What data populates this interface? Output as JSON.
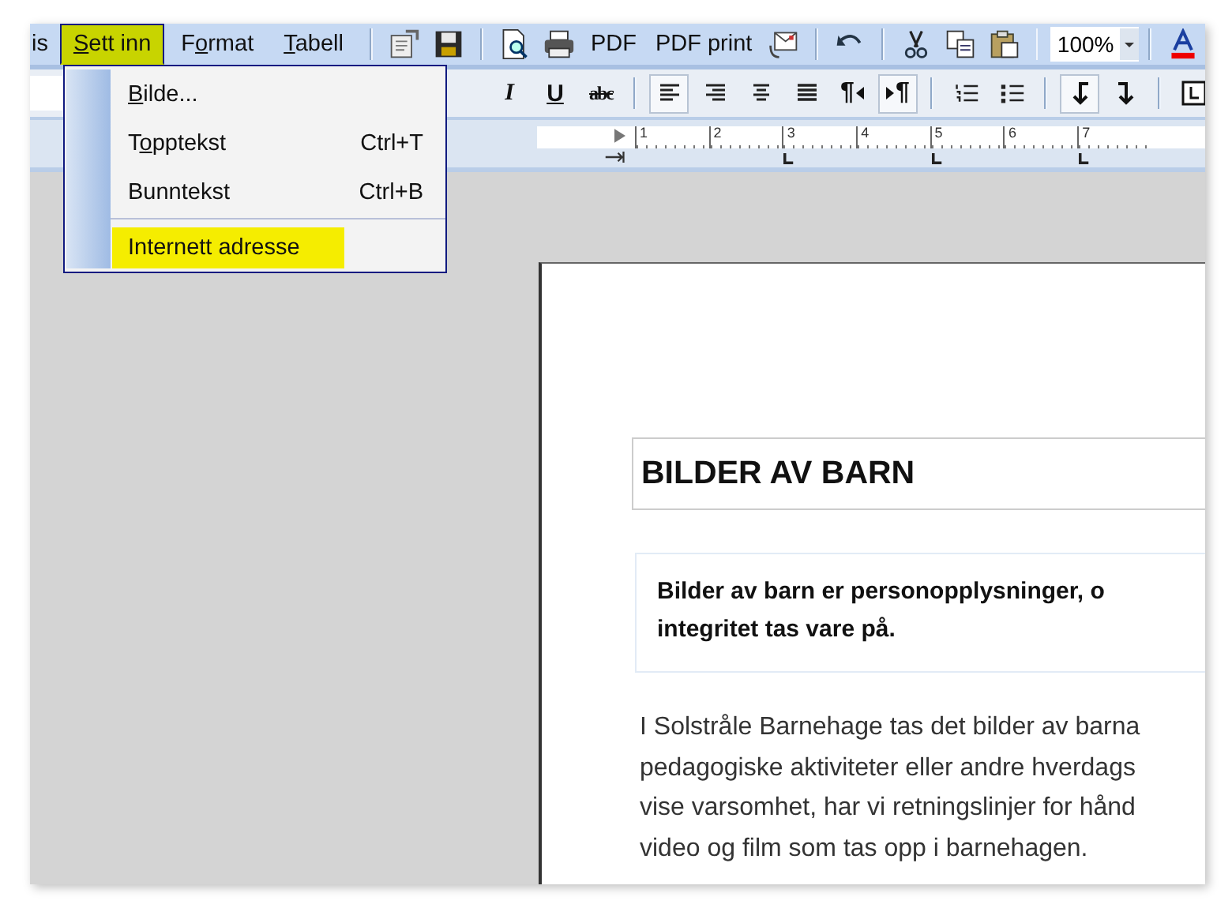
{
  "menu_bar": [
    {
      "label": {
        "before": "is"
      },
      "selected": false
    },
    {
      "label": {
        "key": "S",
        "after": "ett inn"
      },
      "selected": true
    },
    {
      "label": {
        "before": "F",
        "key": "o",
        "after": "rmat"
      },
      "selected": false
    },
    {
      "label": {
        "key": "T",
        "after": "abell"
      },
      "selected": false
    }
  ],
  "toolbar": [
    {
      "kind": "separator"
    },
    {
      "kind": "properties"
    },
    {
      "kind": "save"
    },
    {
      "kind": "separator"
    },
    {
      "kind": "preview"
    },
    {
      "kind": "print"
    },
    {
      "kind": "text",
      "label": "PDF"
    },
    {
      "kind": "text",
      "label": "PDF print"
    },
    {
      "kind": "mail"
    },
    {
      "kind": "separator"
    },
    {
      "kind": "undo"
    },
    {
      "kind": "separator"
    },
    {
      "kind": "cut"
    },
    {
      "kind": "copy"
    },
    {
      "kind": "paste"
    },
    {
      "kind": "separator"
    },
    {
      "kind": "zoom",
      "value": "100%"
    },
    {
      "kind": "separator"
    },
    {
      "kind": "font-color"
    }
  ],
  "format_toolbar": [
    {
      "kind": "italic",
      "label": "I",
      "pressed": false
    },
    {
      "kind": "underline",
      "label": "U",
      "pressed": false
    },
    {
      "kind": "strike",
      "label": "abc",
      "pressed": false
    },
    {
      "kind": "separator"
    },
    {
      "kind": "align-left",
      "pressed": true
    },
    {
      "kind": "align-right",
      "pressed": false
    },
    {
      "kind": "align-center",
      "pressed": false
    },
    {
      "kind": "justify",
      "pressed": false
    },
    {
      "kind": "para-rtl",
      "label": "¶",
      "pressed": false
    },
    {
      "kind": "para-ltr",
      "label": "¶",
      "pressed": true
    },
    {
      "kind": "separator"
    },
    {
      "kind": "numbered-list",
      "pressed": false
    },
    {
      "kind": "bullet-list",
      "pressed": false
    },
    {
      "kind": "separator"
    },
    {
      "kind": "arrow-left-down",
      "pressed": true
    },
    {
      "kind": "arrow-right-down",
      "pressed": false
    },
    {
      "kind": "separator"
    },
    {
      "kind": "frame",
      "pressed": false
    }
  ],
  "ruler": {
    "numbers": [
      "1",
      "2",
      "3",
      "4",
      "5",
      "6",
      "7"
    ]
  },
  "dropdown": {
    "items": [
      {
        "kind": "item",
        "label": {
          "key": "B",
          "after": "ilde..."
        },
        "selected": false
      },
      {
        "kind": "item",
        "label": {
          "before": "T",
          "key": "o",
          "after": "pptekst"
        },
        "shortcut": "Ctrl+T",
        "selected": false
      },
      {
        "kind": "item",
        "label": {
          "before": "Bunntekst"
        },
        "shortcut": "Ctrl+B",
        "selected": false
      },
      {
        "kind": "separator"
      },
      {
        "kind": "item",
        "label": {
          "before": "Internett adresse"
        },
        "selected": true
      }
    ]
  },
  "document": {
    "heading": "BILDER AV BARN",
    "callout": [
      "Bilder av barn er personopplysninger, o",
      "integritet tas vare på."
    ],
    "paragraph": [
      "I Solstråle Barnehage tas det bilder av barna",
      "pedagogiske aktiviteter eller andre hverdags",
      "vise varsomhet, har vi retningslinjer for hånd",
      "video og film som tas opp i barnehagen."
    ]
  }
}
